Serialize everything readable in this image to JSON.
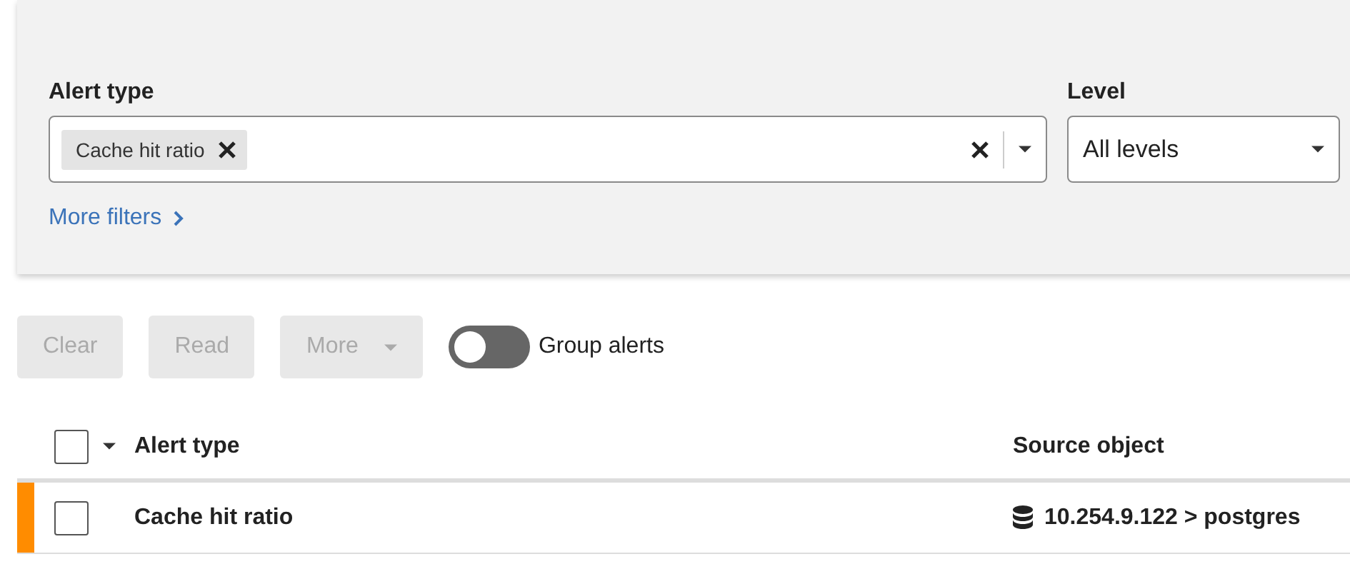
{
  "filters": {
    "alert_type": {
      "label": "Alert type",
      "chips": [
        {
          "label": "Cache hit ratio"
        }
      ]
    },
    "level": {
      "label": "Level",
      "value": "All levels"
    },
    "more_filters": "More filters"
  },
  "toolbar": {
    "buttons": [
      {
        "label": "Clear",
        "disabled": true,
        "dropdown": false
      },
      {
        "label": "Read",
        "disabled": true,
        "dropdown": false
      },
      {
        "label": "More",
        "disabled": true,
        "dropdown": true
      }
    ],
    "group_toggle": {
      "label": "Group alerts",
      "on": false
    }
  },
  "table": {
    "select_all_checked": false,
    "columns": [
      "Alert type",
      "Source object"
    ],
    "rows": [
      {
        "checked": false,
        "color": "#ff8c00",
        "alert_type": "Cache hit ratio",
        "source_object": "10.254.9.122 > postgres"
      }
    ]
  }
}
